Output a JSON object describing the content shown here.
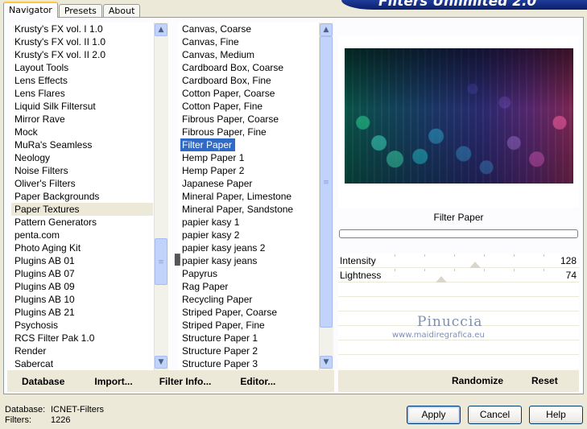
{
  "tabs": [
    {
      "label": "Navigator",
      "active": true
    },
    {
      "label": "Presets",
      "active": false
    },
    {
      "label": "About",
      "active": false
    }
  ],
  "banner_title": "Filters Unlimited 2.0",
  "categories": {
    "items": [
      "Krusty's FX vol. I 1.0",
      "Krusty's FX vol. II 1.0",
      "Krusty's FX vol. II 2.0",
      "Layout Tools",
      "Lens Effects",
      "Lens Flares",
      "Liquid Silk Filtersut",
      "Mirror Rave",
      "Mock",
      "MuRa's Seamless",
      "Neology",
      "Noise Filters",
      "Oliver's Filters",
      "Paper Backgrounds",
      "Paper Textures",
      "Pattern Generators",
      "penta.com",
      "Photo Aging Kit",
      "Plugins AB 01",
      "Plugins AB 07",
      "Plugins AB 09",
      "Plugins AB 10",
      "Plugins AB 21",
      "Psychosis",
      "RCS Filter Pak 1.0",
      "Render",
      "Sabercat"
    ],
    "selected": "Paper Textures"
  },
  "filters": {
    "items": [
      "Canvas, Coarse",
      "Canvas, Fine",
      "Canvas, Medium",
      "Cardboard Box, Coarse",
      "Cardboard Box, Fine",
      "Cotton Paper, Coarse",
      "Cotton Paper, Fine",
      "Fibrous Paper, Coarse",
      "Fibrous Paper, Fine",
      "Filter Paper",
      "Hemp Paper 1",
      "Hemp Paper 2",
      "Japanese Paper",
      "Mineral Paper, Limestone",
      "Mineral Paper, Sandstone",
      "papier kasy 1",
      "papier kasy 2",
      "papier kasy jeans 2",
      "papier kasy jeans",
      "Papyrus",
      "Rag Paper",
      "Recycling Paper",
      "Striped Paper, Coarse",
      "Striped Paper, Fine",
      "Structure Paper 1",
      "Structure Paper 2",
      "Structure Paper 3"
    ],
    "selected": "Filter Paper"
  },
  "left_buttons": {
    "database": "Database",
    "import": "Import...",
    "filter_info": "Filter Info...",
    "editor": "Editor..."
  },
  "right_buttons": {
    "randomize": "Randomize",
    "reset": "Reset"
  },
  "current_filter_name": "Filter Paper",
  "sliders": [
    {
      "label": "Intensity",
      "value": "128",
      "fraction": 0.5
    },
    {
      "label": "Lightness",
      "value": "74",
      "fraction": 0.29
    }
  ],
  "watermark": {
    "name": "Pinuccia",
    "url": "www.maidiregrafica.eu"
  },
  "status": {
    "database_label": "Database:",
    "database_value": "ICNET-Filters",
    "filters_label": "Filters:",
    "filters_value": "1226"
  },
  "dialog_buttons": {
    "apply": "Apply",
    "cancel": "Cancel",
    "help": "Help"
  }
}
